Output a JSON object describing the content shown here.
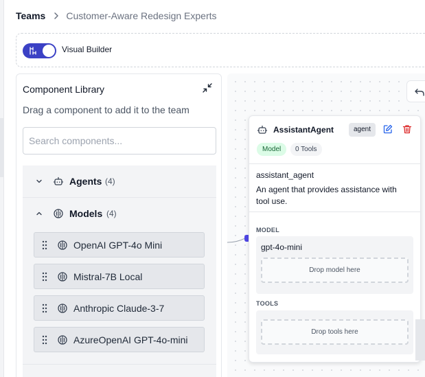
{
  "breadcrumb": {
    "root": "Teams",
    "current": "Customer-Aware Redesign Experts"
  },
  "toolbar": {
    "toggle_label": "Visual Builder",
    "toggle_on": true
  },
  "library": {
    "title": "Component Library",
    "subtitle": "Drag a component to add it to the team",
    "search_placeholder": "Search components...",
    "groups": [
      {
        "name": "Agents",
        "count": "(4)",
        "expanded": false,
        "icon": "robot-icon"
      },
      {
        "name": "Models",
        "count": "(4)",
        "expanded": true,
        "icon": "brain-icon",
        "items": [
          {
            "label": "OpenAI GPT-4o Mini"
          },
          {
            "label": "Mistral-7B Local"
          },
          {
            "label": "Anthropic Claude-3-7"
          },
          {
            "label": "AzureOpenAI GPT-4o-mini"
          }
        ]
      }
    ]
  },
  "node": {
    "title": "AssistantAgent",
    "type_badge": "agent",
    "model_badge": "Model",
    "tools_badge": "0 Tools",
    "name": "assistant_agent",
    "description": "An agent that provides assistance with tool use.",
    "model_section_label": "MODEL",
    "model_name": "gpt-4o-mini",
    "model_drop_text": "Drop model here",
    "tools_section_label": "TOOLS",
    "tools_drop_text": "Drop tools here"
  },
  "colors": {
    "accent": "#3b41c5",
    "delete": "#dc2626",
    "edit": "#2563eb",
    "model_badge_bg": "#dcfce7",
    "model_badge_text": "#166534"
  }
}
